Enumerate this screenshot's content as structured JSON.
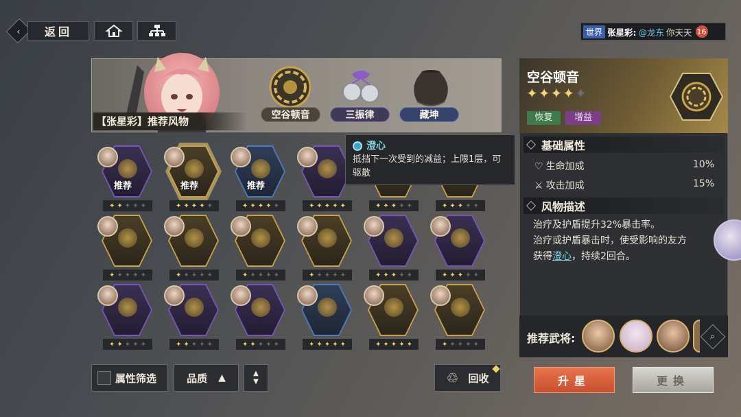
{
  "topbar": {
    "back_label": "返回",
    "home_icon": "home-icon",
    "tree_icon": "hierarchy-icon"
  },
  "chat": {
    "channel": "世界",
    "speaker": "张星彩:",
    "mention": "@龙东",
    "message": "你天天",
    "unread": "16"
  },
  "banner": {
    "title": "【张星彩】推荐风物",
    "items": [
      "空谷顿音",
      "三振律",
      "藏坤"
    ]
  },
  "tooltip": {
    "title": "澄心",
    "text": "抵挡下一次受到的减益；上限1层，可驱散"
  },
  "grid": {
    "rec_label": "推荐",
    "rows": [
      [
        {
          "stars": 2,
          "max": 5,
          "rec": true,
          "frame": "purple"
        },
        {
          "stars": 4,
          "max": 5,
          "rec": true,
          "frame": "gold"
        },
        {
          "stars": 4,
          "max": 5,
          "rec": true,
          "frame": "blue"
        },
        {
          "stars": 5,
          "max": 5,
          "rec": false,
          "frame": "purple"
        },
        {
          "stars": 3,
          "max": 5,
          "rec": false,
          "frame": "gold"
        },
        {
          "stars": 3,
          "max": 5,
          "rec": false,
          "frame": "gold"
        }
      ],
      [
        {
          "stars": 1,
          "max": 5,
          "rec": false,
          "frame": "gold"
        },
        {
          "stars": 1,
          "max": 5,
          "rec": false,
          "frame": "gold"
        },
        {
          "stars": 1,
          "max": 5,
          "rec": false,
          "frame": "gold"
        },
        {
          "stars": 1,
          "max": 5,
          "rec": false,
          "frame": "gold"
        },
        {
          "stars": 3,
          "max": 5,
          "rec": false,
          "frame": "purple"
        },
        {
          "stars": 3,
          "max": 5,
          "rec": false,
          "frame": "purple"
        }
      ],
      [
        {
          "stars": 2,
          "max": 5,
          "rec": false,
          "frame": "purple"
        },
        {
          "stars": 2,
          "max": 5,
          "rec": false,
          "frame": "purple"
        },
        {
          "stars": 2,
          "max": 5,
          "rec": false,
          "frame": "purple"
        },
        {
          "stars": 5,
          "max": 5,
          "rec": false,
          "frame": "blue"
        },
        {
          "stars": 5,
          "max": 5,
          "rec": false,
          "frame": "gold"
        },
        {
          "stars": 1,
          "max": 5,
          "rec": false,
          "frame": "gold"
        }
      ]
    ]
  },
  "controls": {
    "filter_label": "属性筛选",
    "sort_label": "品质",
    "recycle_label": "回收"
  },
  "detail": {
    "name": "空谷顿音",
    "stars": 4,
    "max_stars": 5,
    "tags": [
      "恢复",
      "增益"
    ],
    "basic_title": "基础属性",
    "attrs": [
      {
        "label": "生命加成",
        "value": "10%"
      },
      {
        "label": "攻击加成",
        "value": "15%"
      }
    ],
    "desc_title": "风物描述",
    "desc_line1": "治疗及护盾提升32%暴击率。",
    "desc_line2": "治疗或护盾暴击时，使受影响的友方",
    "desc_pre": "获得",
    "desc_kw": "澄心",
    "desc_post": "，持续2回合。",
    "rec_generals_label": "推荐武将:",
    "upgrade_label": "升星",
    "replace_label": "更换"
  },
  "colors": {
    "accent_orange": "#e0643a",
    "gold": "#c9a34a",
    "teal_keyword": "#7fd6e0",
    "tag_recover": "#3f7a4d",
    "tag_buff": "#7a3f86"
  }
}
